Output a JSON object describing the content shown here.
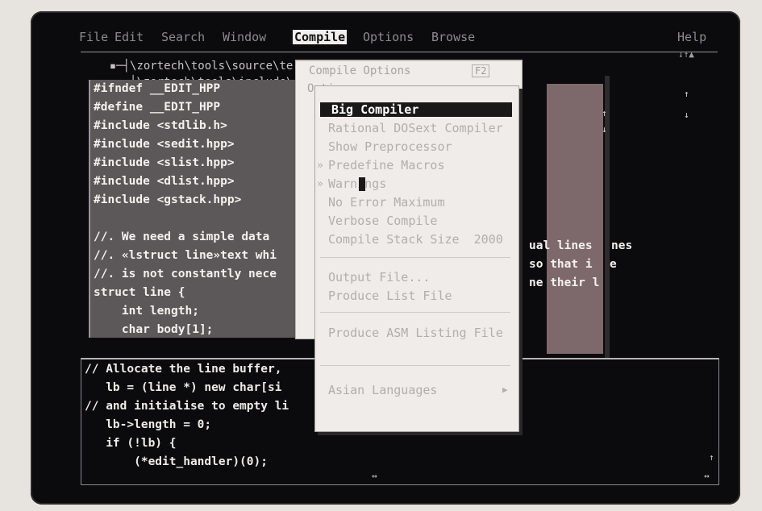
{
  "menubar": {
    "items": [
      "File",
      "Edit",
      "Search",
      "Window",
      "Compile",
      "Options",
      "Browse",
      "Help"
    ],
    "active": "Compile"
  },
  "paths": {
    "window1": "\\zortech\\tools\\source\\te",
    "window2": "\\zortech\\tools\\include\\"
  },
  "editor": {
    "lines": [
      "#ifndef __EDIT_HPP",
      "#define __EDIT_HPP",
      "#include <stdlib.h>",
      "#include <sedit.hpp>",
      "#include <slist.hpp>",
      "#include <dlist.hpp>",
      "#include <gstack.hpp>",
      "",
      "//. We need a simple data",
      "//. «lstruct line»text whi",
      "//. is not constantly nece",
      "struct line {",
      "    int length;",
      "    char body[1];"
    ],
    "right_fragments": [
      "ual lines",
      "nes",
      "so that i",
      "e",
      "ne their l"
    ]
  },
  "lower": {
    "lines": [
      "// Allocate the line buffer,",
      "   lb = (line *) new char[si",
      "// and initialise to empty li",
      "   lb->length = 0;",
      "   if (!lb) {",
      "       (*edit_handler)(0);"
    ],
    "hscroll": "↔"
  },
  "dialog": {
    "title": "Compile Options",
    "group": "Options",
    "help_hint": "F2"
  },
  "compile_menu": {
    "items": [
      {
        "label": "Big Compiler",
        "selected": true,
        "marker": ""
      },
      {
        "label": "Rational DOSext Compiler",
        "selected": false,
        "marker": ""
      },
      {
        "label": "Show Preprocessor",
        "selected": false,
        "marker": ""
      },
      {
        "label": "Predefine Macros",
        "selected": false,
        "marker": "»"
      },
      {
        "label": "Warnings",
        "selected": false,
        "marker": "»"
      },
      {
        "label": "No Error Maximum",
        "selected": false,
        "marker": ""
      },
      {
        "label": "Verbose Compile",
        "selected": false,
        "marker": ""
      },
      {
        "label": "Compile Stack Size  2000",
        "selected": false,
        "marker": ""
      },
      {
        "label": "Output File...",
        "selected": false,
        "marker": ""
      },
      {
        "label": "Produce List File",
        "selected": false,
        "marker": ""
      },
      {
        "label": "Produce ASM Listing File",
        "selected": false,
        "marker": ""
      },
      {
        "label": "Asian Languages",
        "selected": false,
        "marker": ""
      }
    ],
    "submenu_arrow": "▶"
  },
  "scroll_symbols": {
    "up": "↑",
    "down": "↓",
    "updown": "↓↑▲",
    "lr": "↔"
  }
}
